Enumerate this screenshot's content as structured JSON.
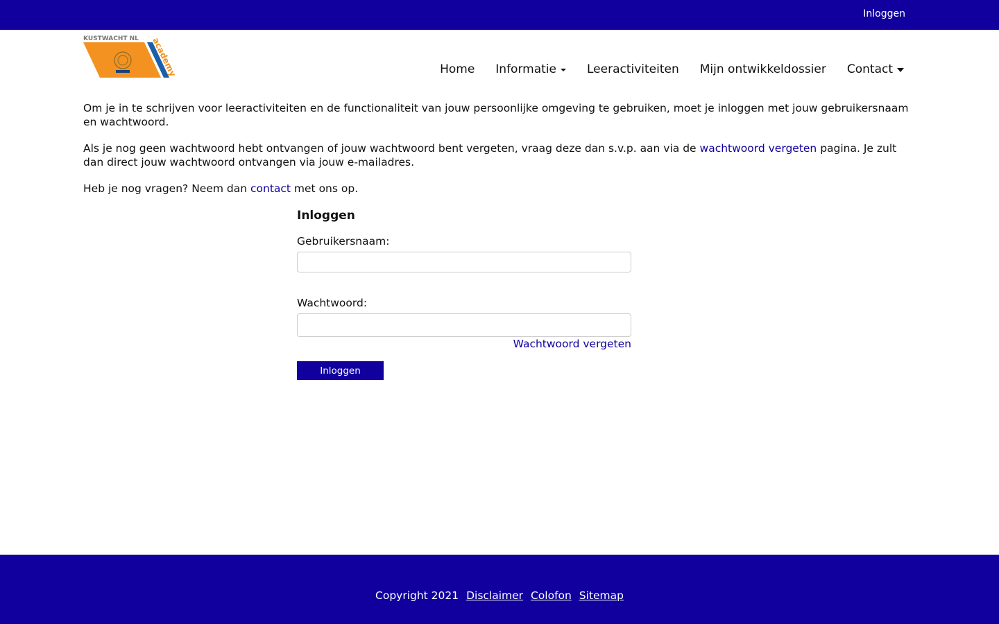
{
  "colors": {
    "brand": "#11009e",
    "logo_orange": "#f39220",
    "logo_blue": "#1c5fa8"
  },
  "topbar": {
    "login_label": "Inloggen"
  },
  "logo": {
    "brand_text": "KUSTWACHT NL",
    "sub_text": "academy"
  },
  "nav": {
    "items": [
      {
        "label": "Home",
        "dropdown": false
      },
      {
        "label": "Informatie",
        "dropdown": true
      },
      {
        "label": "Leeractiviteiten",
        "dropdown": false
      },
      {
        "label": "Mijn ontwikkeldossier",
        "dropdown": false
      },
      {
        "label": "Contact",
        "dropdown": true
      }
    ]
  },
  "intro": {
    "p1": "Om je in te schrijven voor leeractiviteiten en de functionaliteit van jouw persoonlijke omgeving te gebruiken, moet je inloggen met jouw gebruikersnaam en wachtwoord.",
    "p2_before": "Als je nog geen wachtwoord hebt ontvangen of jouw wachtwoord bent vergeten, vraag deze dan s.v.p. aan via de ",
    "p2_link": "wachtwoord vergeten",
    "p2_after": " pagina. Je zult dan direct jouw wachtwoord ontvangen via jouw e-mailadres.",
    "p3_before": "Heb je nog vragen? Neem dan ",
    "p3_link": "contact",
    "p3_after": " met ons op."
  },
  "login_form": {
    "title": "Inloggen",
    "username_label": "Gebruikersnaam:",
    "username_value": "",
    "password_label": "Wachtwoord:",
    "password_value": "",
    "forgot_label": "Wachtwoord vergeten",
    "submit_label": "Inloggen"
  },
  "footer": {
    "copyright": "Copyright 2021",
    "links": [
      "Disclaimer",
      "Colofon",
      "Sitemap"
    ]
  }
}
